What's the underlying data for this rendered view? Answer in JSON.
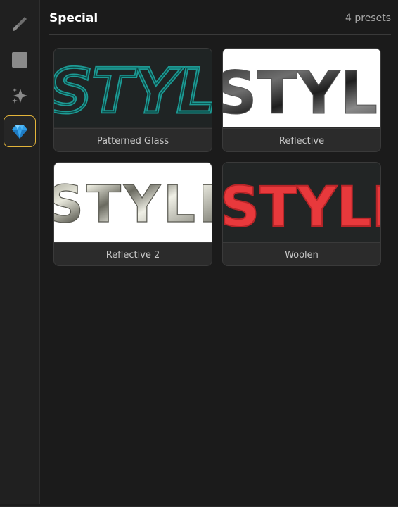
{
  "sidebar": {
    "tools": [
      {
        "icon": "brush-icon",
        "active": false
      },
      {
        "icon": "square-icon",
        "active": false
      },
      {
        "icon": "sparkle-icon",
        "active": false
      },
      {
        "icon": "diamond-icon",
        "active": true
      }
    ],
    "active_color": "#e3b43a"
  },
  "header": {
    "title": "Special",
    "count": "4 presets"
  },
  "presets": [
    {
      "label": "Patterned Glass",
      "thumb_text": "STYLE"
    },
    {
      "label": "Reflective",
      "thumb_text": "STYLE"
    },
    {
      "label": "Reflective 2",
      "thumb_text": "STYLE"
    },
    {
      "label": "Woolen",
      "thumb_text": "STYLE"
    }
  ]
}
